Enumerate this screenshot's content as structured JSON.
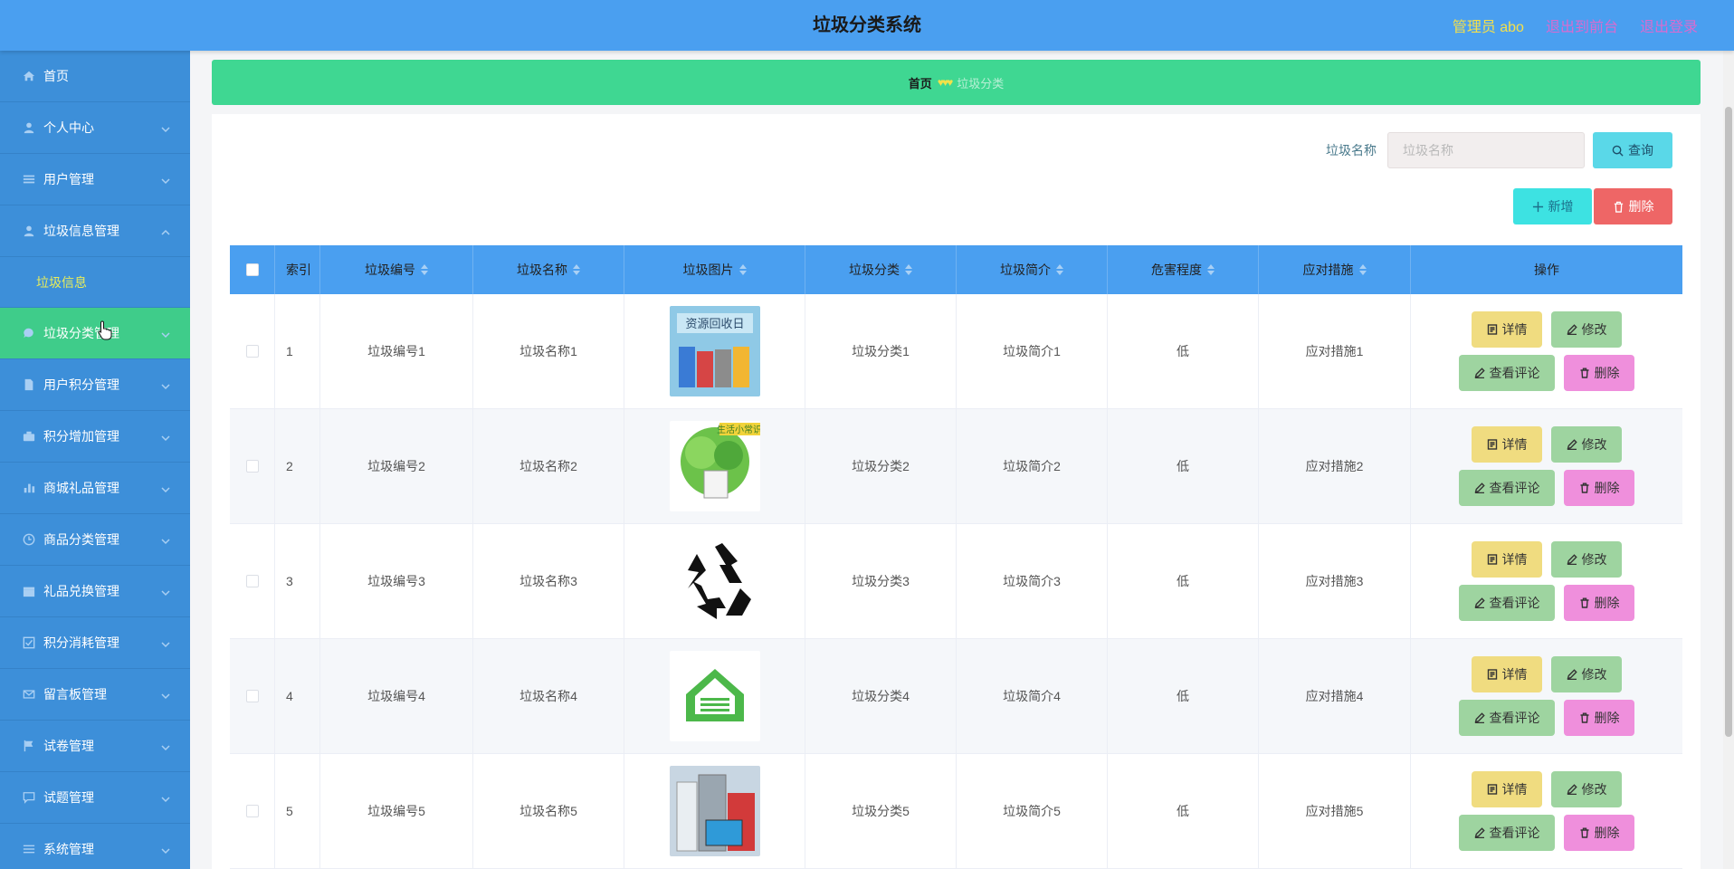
{
  "header": {
    "title": "垃圾分类系统",
    "admin": "管理员 abo",
    "front_link": "退出到前台",
    "logout_link": "退出登录"
  },
  "sidebar": {
    "items": [
      {
        "label": "首页",
        "icon": "home-icon"
      },
      {
        "label": "个人中心",
        "icon": "user-icon"
      },
      {
        "label": "用户管理",
        "icon": "list-icon"
      },
      {
        "label": "垃圾信息管理",
        "icon": "user-icon",
        "expanded": true
      },
      {
        "label": "垃圾分类管理",
        "icon": "chat-icon",
        "active": true
      },
      {
        "label": "用户积分管理",
        "icon": "document-icon"
      },
      {
        "label": "积分增加管理",
        "icon": "briefcase-icon"
      },
      {
        "label": "商城礼品管理",
        "icon": "chart-icon"
      },
      {
        "label": "商品分类管理",
        "icon": "clock-icon"
      },
      {
        "label": "礼品兑换管理",
        "icon": "gift-icon"
      },
      {
        "label": "积分消耗管理",
        "icon": "check-icon"
      },
      {
        "label": "留言板管理",
        "icon": "mail-icon"
      },
      {
        "label": "试卷管理",
        "icon": "flag-icon"
      },
      {
        "label": "试题管理",
        "icon": "comment-icon"
      },
      {
        "label": "系统管理",
        "icon": "menu-icon"
      }
    ],
    "submenu_label": "垃圾信息"
  },
  "breadcrumb": {
    "home": "首页",
    "current": "垃圾分类"
  },
  "search": {
    "label": "垃圾名称",
    "placeholder": "垃圾名称",
    "value": "",
    "query_label": "查询"
  },
  "toolbar": {
    "add_label": "新增",
    "delete_label": "删除"
  },
  "table": {
    "columns": [
      "索引",
      "垃圾编号",
      "垃圾名称",
      "垃圾图片",
      "垃圾分类",
      "垃圾简介",
      "危害程度",
      "应对措施",
      "操作"
    ],
    "rows": [
      {
        "index": "1",
        "code": "垃圾编号1",
        "name": "垃圾名称1",
        "image": "资源回收日",
        "category": "垃圾分类1",
        "intro": "垃圾简介1",
        "level": "低",
        "measure": "应对措施1"
      },
      {
        "index": "2",
        "code": "垃圾编号2",
        "name": "垃圾名称2",
        "image": "生活小常识",
        "category": "垃圾分类2",
        "intro": "垃圾简介2",
        "level": "低",
        "measure": "应对措施2"
      },
      {
        "index": "3",
        "code": "垃圾编号3",
        "name": "垃圾名称3",
        "image": "",
        "category": "垃圾分类3",
        "intro": "垃圾简介3",
        "level": "低",
        "measure": "应对措施3"
      },
      {
        "index": "4",
        "code": "垃圾编号4",
        "name": "垃圾名称4",
        "image": "",
        "category": "垃圾分类4",
        "intro": "垃圾简介4",
        "level": "低",
        "measure": "应对措施4"
      },
      {
        "index": "5",
        "code": "垃圾编号5",
        "name": "垃圾名称5",
        "image": "",
        "category": "垃圾分类5",
        "intro": "垃圾简介5",
        "level": "低",
        "measure": "应对措施5"
      }
    ],
    "actions": {
      "detail": "详情",
      "edit": "修改",
      "review": "查看评论",
      "delete": "删除"
    }
  },
  "colors": {
    "header": "#4a9ff0",
    "sidebar": "#3d8fd9",
    "active": "#3fcc8a",
    "breadcrumb": "#3fd792"
  }
}
